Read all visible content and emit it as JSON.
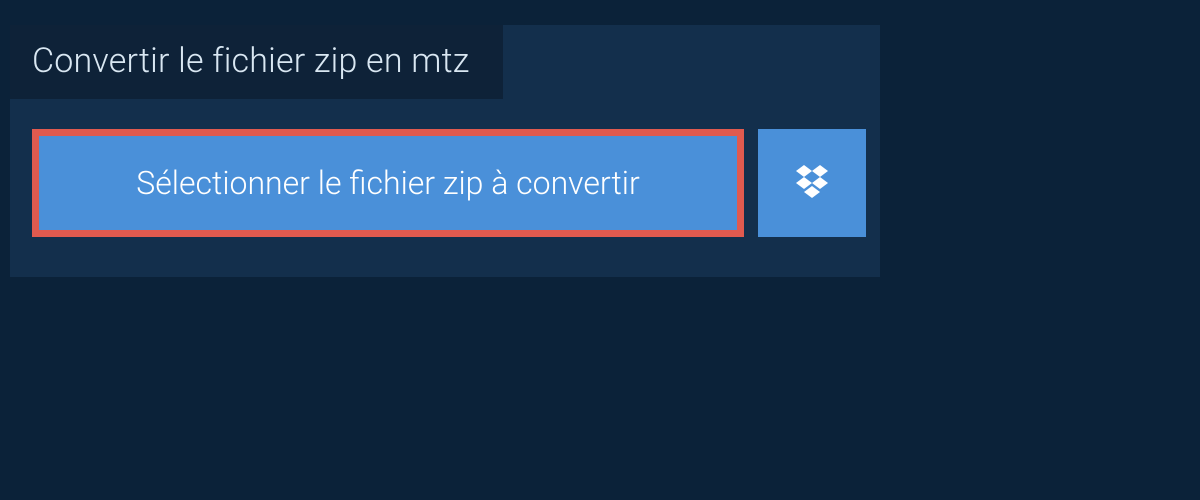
{
  "header": {
    "title": "Convertir le fichier zip en mtz"
  },
  "buttons": {
    "select_label": "Sélectionner le fichier zip à convertir"
  },
  "icons": {
    "dropbox": "dropbox-icon"
  },
  "colors": {
    "page_bg": "#0b2239",
    "panel_bg": "#132f4c",
    "header_bg": "#0e2238",
    "button_bg": "#4a90d9",
    "highlight_border": "#e05a4f",
    "text_light": "#d9e7f2",
    "text_white": "#ffffff"
  }
}
